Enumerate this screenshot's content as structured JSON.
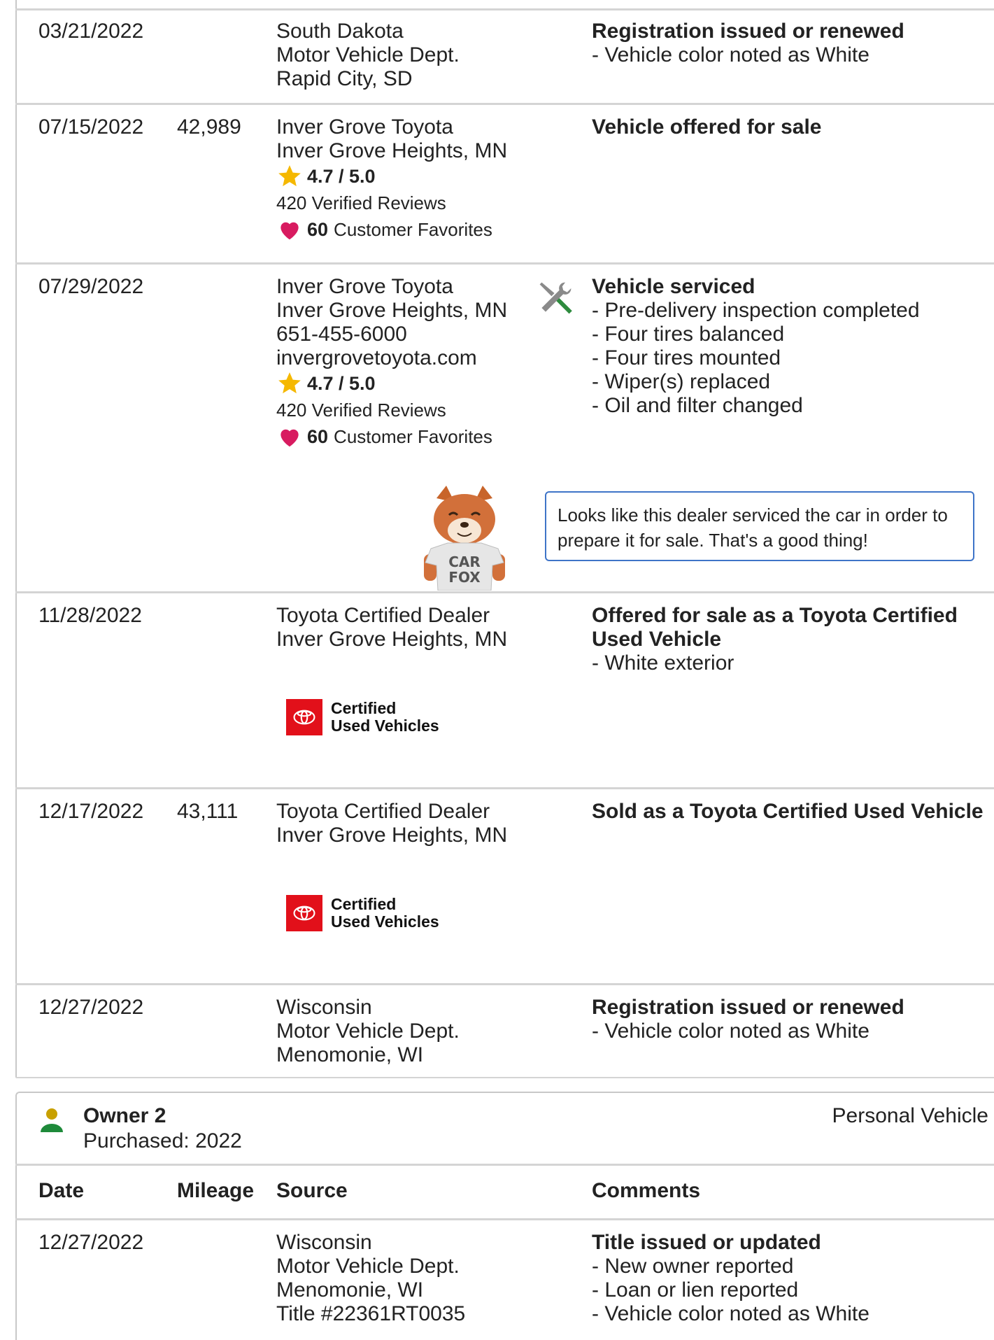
{
  "rows": [
    {
      "date": "03/21/2022",
      "mileage": "",
      "source": [
        "South Dakota",
        "Motor Vehicle Dept.",
        "Rapid City, SD"
      ],
      "comment_title": "Registration issued or renewed",
      "comments": [
        "Vehicle color noted as White"
      ]
    },
    {
      "date": "07/15/2022",
      "mileage": "42,989",
      "source": [
        "Inver Grove Toyota",
        "Inver Grove Heights, MN"
      ],
      "rating": "4.7 / 5.0",
      "reviews": "420 Verified Reviews",
      "favorites_count": "60",
      "favorites_label": "Customer Favorites",
      "comment_title": "Vehicle offered for sale",
      "comments": []
    },
    {
      "date": "07/29/2022",
      "mileage": "",
      "source": [
        "Inver Grove Toyota",
        "Inver Grove Heights, MN",
        "651-455-6000",
        "invergrovetoyota.com"
      ],
      "rating": "4.7 / 5.0",
      "reviews": "420 Verified Reviews",
      "favorites_count": "60",
      "favorites_label": "Customer Favorites",
      "comment_title": "Vehicle serviced",
      "comments": [
        "Pre-delivery inspection completed",
        "Four tires balanced",
        "Four tires mounted",
        "Wiper(s) replaced",
        "Oil and filter changed"
      ],
      "tip": "Looks like this dealer serviced the car in order to prepare it for sale. That's a good thing!",
      "fox_shirt": [
        "CAR",
        "FOX"
      ]
    },
    {
      "date": "11/28/2022",
      "mileage": "",
      "source": [
        "Toyota Certified Dealer",
        "Inver Grove Heights, MN"
      ],
      "badge": [
        "Certified",
        "Used Vehicles"
      ],
      "comment_title": "Offered for sale as a Toyota Certified Used Vehicle",
      "comments": [
        "White exterior"
      ]
    },
    {
      "date": "12/17/2022",
      "mileage": "43,111",
      "source": [
        "Toyota Certified Dealer",
        "Inver Grove Heights, MN"
      ],
      "badge": [
        "Certified",
        "Used Vehicles"
      ],
      "comment_title": "Sold as a Toyota Certified Used Vehicle",
      "comments": []
    },
    {
      "date": "12/27/2022",
      "mileage": "",
      "source": [
        "Wisconsin",
        "Motor Vehicle Dept.",
        "Menomonie, WI"
      ],
      "comment_title": "Registration issued or renewed",
      "comments": [
        "Vehicle color noted as White"
      ]
    }
  ],
  "owner": {
    "title": "Owner 2",
    "purchased": "Purchased: 2022",
    "type": "Personal Vehicle"
  },
  "headers": {
    "date": "Date",
    "mileage": "Mileage",
    "source": "Source",
    "comments": "Comments"
  },
  "owner_rows": [
    {
      "date": "12/27/2022",
      "source": [
        "Wisconsin",
        "Motor Vehicle Dept.",
        "Menomonie, WI",
        "Title #22361RT0035"
      ],
      "comment_title": "Title issued or updated",
      "comments": [
        "New owner reported",
        "Loan or lien reported",
        "Vehicle color noted as White"
      ]
    }
  ],
  "colors": {
    "star": "#f5b800",
    "heart": "#d81b60",
    "toyota_red": "#e2101a",
    "tip_border": "#3e74c8",
    "owner_icon": "#c8a000"
  }
}
